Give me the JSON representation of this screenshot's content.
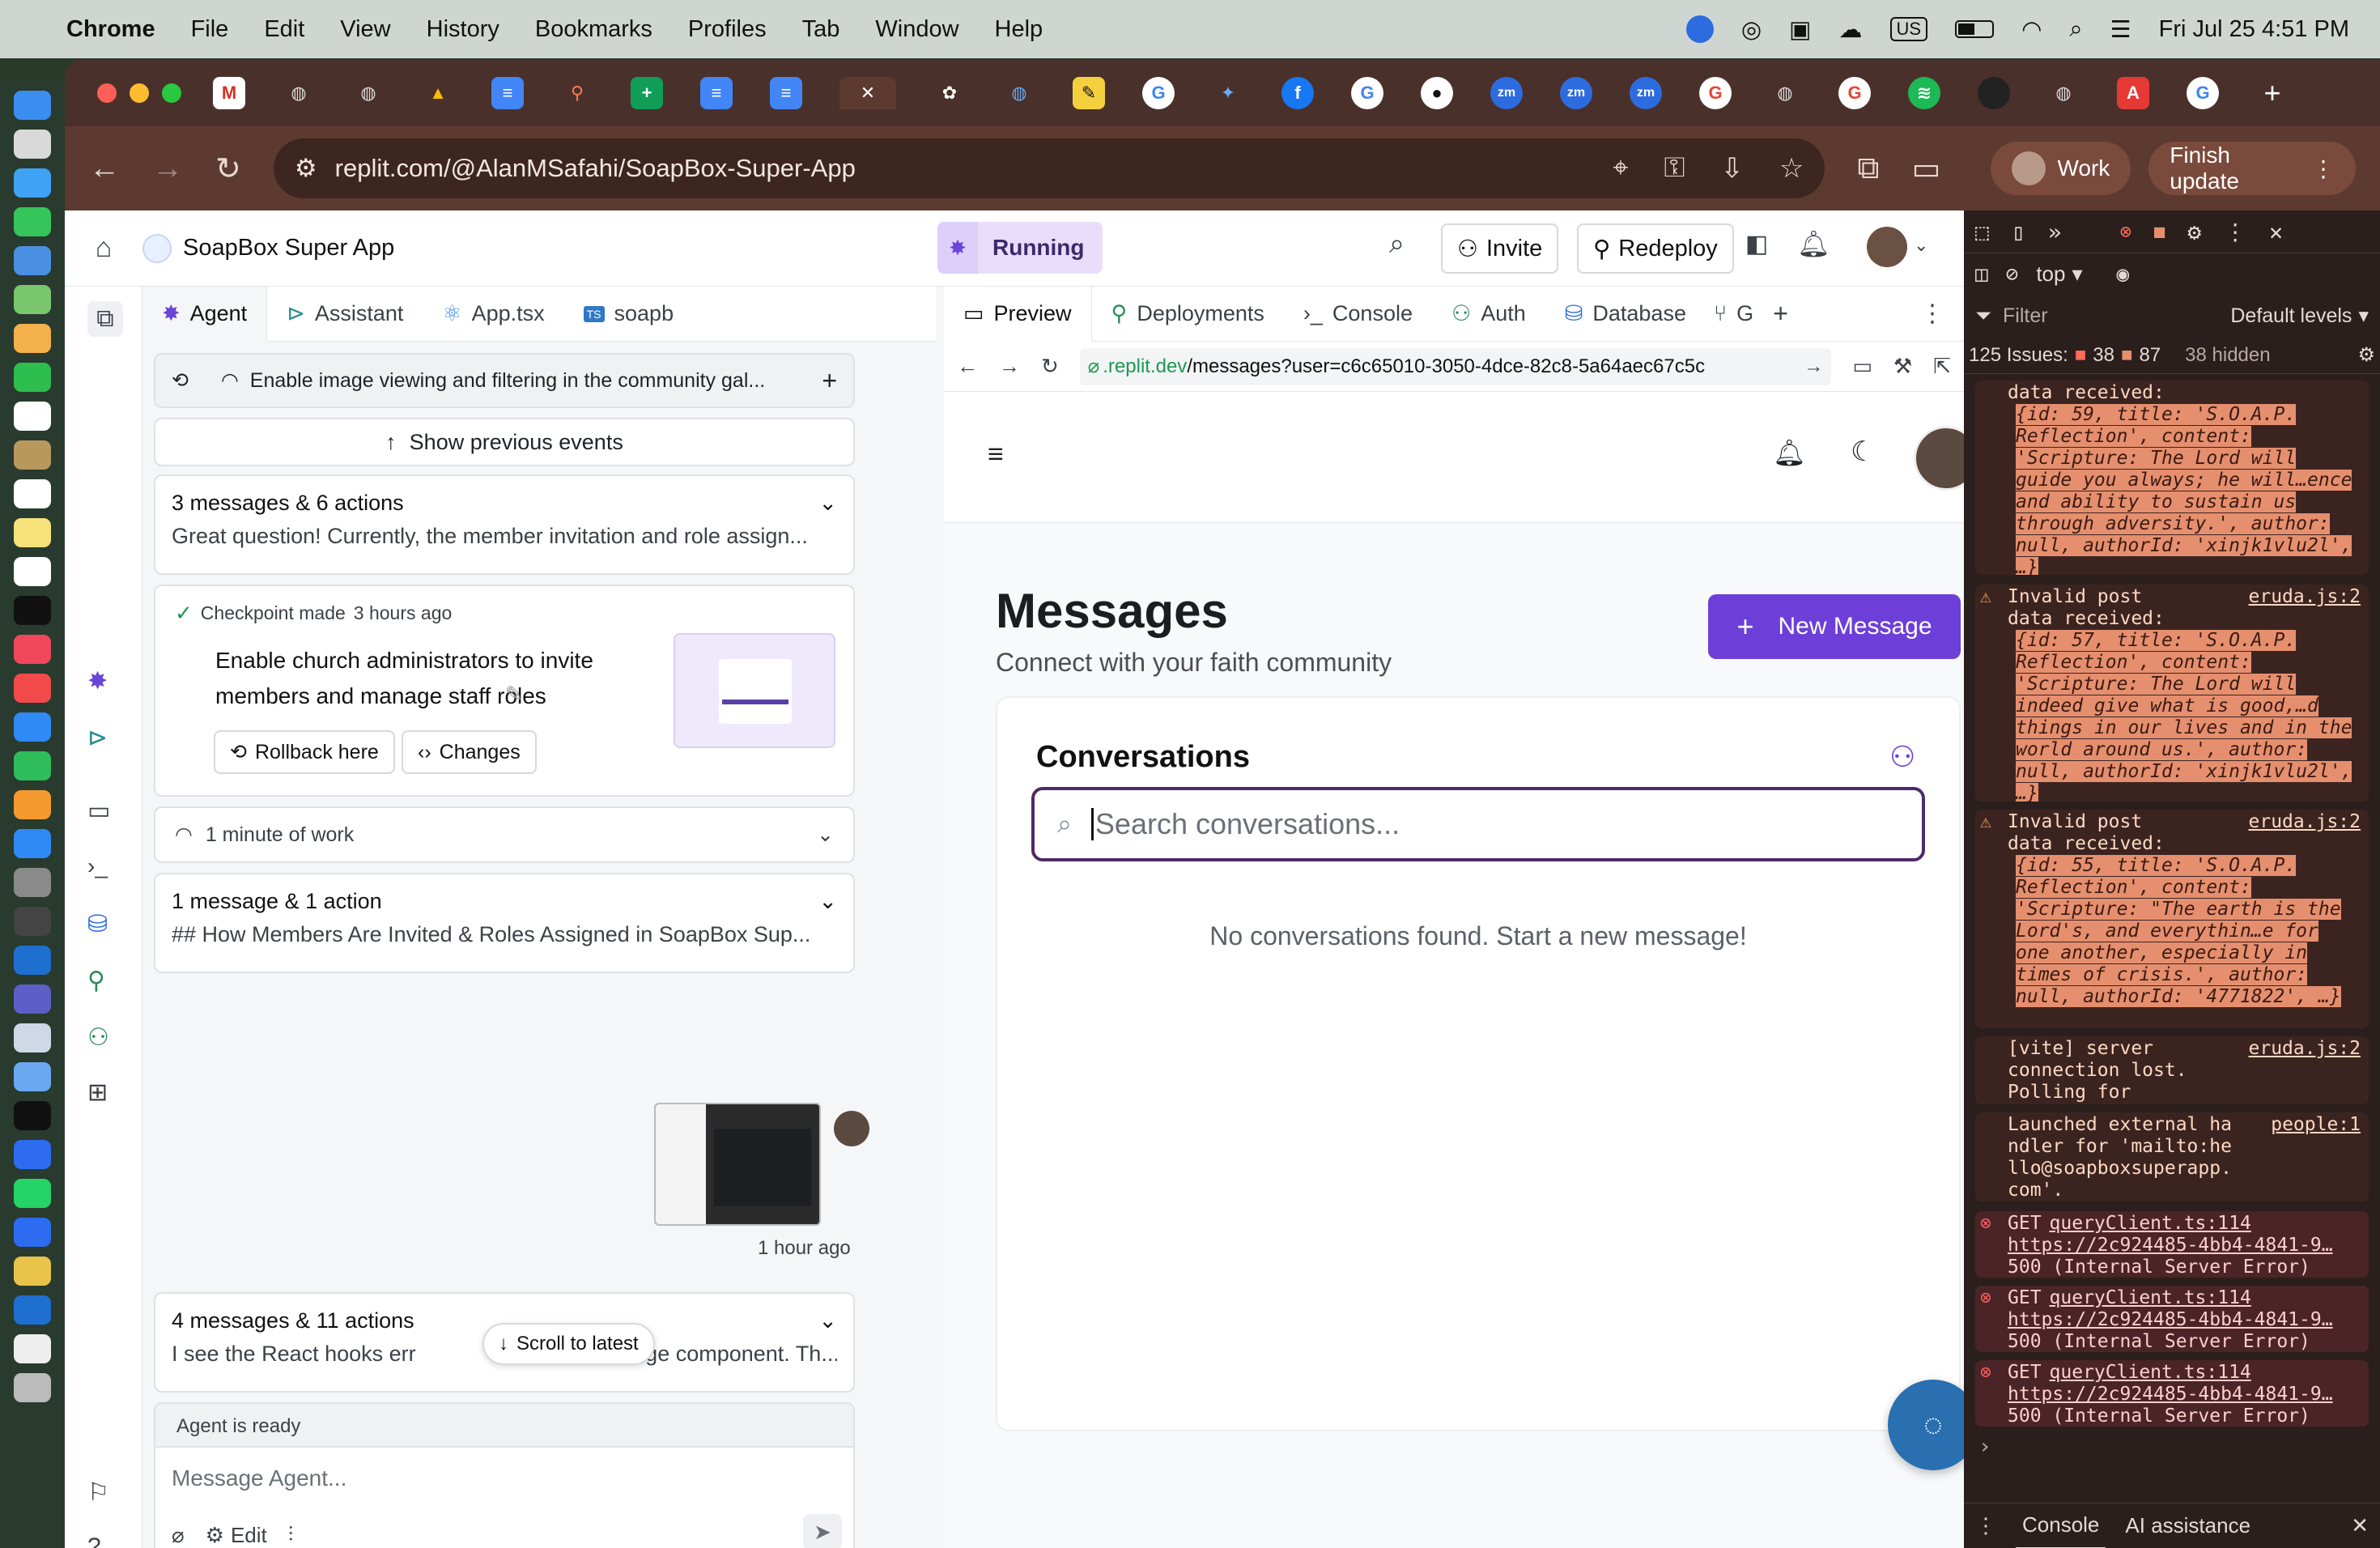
{
  "menubar": {
    "app": "Chrome",
    "items": [
      "File",
      "Edit",
      "View",
      "History",
      "Bookmarks",
      "Profiles",
      "Tab",
      "Window",
      "Help"
    ],
    "lang": "US",
    "clock": "Fri Jul 25  4:51 PM"
  },
  "browser": {
    "url": "replit.com/@AlanMSafahi/SoapBox-Super-App",
    "profile": "Work",
    "finish_update": "Finish update"
  },
  "replit": {
    "project": "SoapBox Super App",
    "status": "Running",
    "invite": "Invite",
    "redeploy": "Redeploy",
    "left_tabs": [
      "Agent",
      "Assistant",
      "App.tsx",
      "soapb"
    ],
    "right_tabs": [
      "Preview",
      "Deployments",
      "Console",
      "Auth",
      "Database",
      "G"
    ],
    "agent": {
      "current_task": "Enable image viewing and filtering in the community gal...",
      "show_previous": "Show previous events",
      "group1_title": "3 messages & 6 actions",
      "group1_preview": "Great question! Currently, the member invitation and role assign...",
      "checkpoint_label": "Checkpoint made",
      "checkpoint_time": "3 hours ago",
      "checkpoint_desc": "Enable church administrators to invite members and manage staff roles",
      "rollback": "Rollback here",
      "changes": "Changes",
      "work_time": "1 minute of work",
      "group2_title": "1 message & 1 action",
      "group2_preview": "## How Members Are Invited & Roles Assigned in SoapBox Sup...",
      "image_time": "1 hour ago",
      "group3_title": "4 messages & 11 actions",
      "group3_preview_a": "I see the React hooks err",
      "group3_preview_b": "rsPage component. Th...",
      "scroll_latest": "Scroll to latest",
      "status": "Agent is ready",
      "input_placeholder": "Message Agent...",
      "edit": "Edit"
    },
    "preview": {
      "url_prefix": ".replit.dev",
      "url_path": "/messages?user=c6c65010-3050-4dce-82c8-5a64aec67c5c",
      "heading": "Messages",
      "subheading": "Connect with your faith community",
      "new_message": "New Message",
      "conversations": "Conversations",
      "search_placeholder": "Search conversations...",
      "empty": "No conversations found. Start a new message!"
    }
  },
  "devtools": {
    "context": "top",
    "filter": "Filter",
    "levels": "Default levels",
    "issues_total": "125 Issues:",
    "issues_err": "38",
    "issues_warn": "87",
    "hidden": "38 hidden",
    "log1_text": "data received:",
    "log1_obj": "{id: 59, title: 'S.O.A.P. Reflection', content: 'Scripture: The Lord will guide you always; he will…ence and ability to sustain us through adversity.', author: null, authorId: 'xinjk1vlu2l', …}",
    "log2_head": "Invalid post data received:",
    "log2_src": "eruda.js:2",
    "log2_obj": "{id: 57, title: 'S.O.A.P. Reflection', content: 'Scripture: The Lord will indeed give what is good,…d things in our lives and in the world around us.', author: null, authorId: 'xinjk1vlu2l', …}",
    "log3_head": "Invalid post data received:",
    "log3_src": "eruda.js:2",
    "log3_obj": "{id: 55, title: 'S.O.A.P. Reflection', content: 'Scripture: \"The earth is the Lord's, and everythin…e for one another, especially in times of crisis.', author: null, authorId: '4771822', …}",
    "log4": "[vite] server connection lost. Polling for restart...",
    "log4_src": "eruda.js:2",
    "log5": "Launched external handler for 'mailto:hello@soapboxsuperapp.com'.",
    "log5_src": "people:1",
    "err_method": "GET",
    "err_src": "queryClient.ts:114",
    "err_url": "https://2c924485-4bb4-4841-9…",
    "err_status": "500 (Internal Server Error)",
    "bottom_tabs": [
      "Console",
      "AI assistance"
    ]
  }
}
